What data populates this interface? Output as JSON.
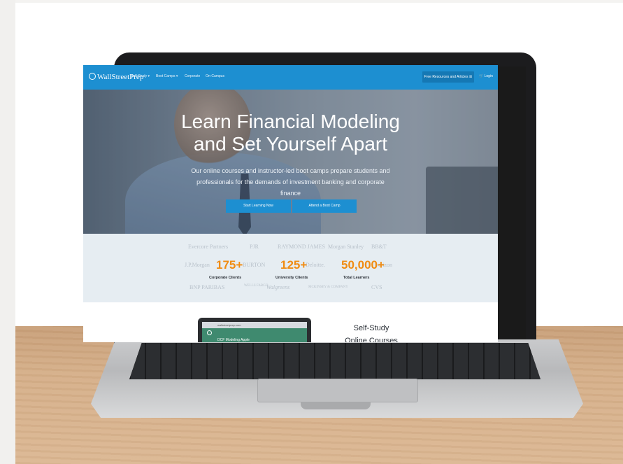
{
  "nav": {
    "logo": "WallStreetPrep",
    "items": [
      "Self-Study ▾",
      "Boot Camps ▾",
      "Corporate",
      "On-Campus"
    ],
    "resources": "Free Resources and Articles ☰",
    "cart_icon": "cart-icon",
    "login": "Login"
  },
  "hero": {
    "title_line1": "Learn Financial Modeling",
    "title_line2": "and Set Yourself Apart",
    "subtitle": "Our online courses and instructor-led boot camps prepare students and professionals for the demands of investment banking and corporate finance",
    "cta_primary": "Start Learning Now",
    "cta_secondary": "Attend a Boot Camp"
  },
  "logos": {
    "row1": [
      "Evercore Partners",
      "PJR",
      "RAYMOND JAMES",
      "Morgan Stanley",
      "BB&T"
    ],
    "row2_left": "J.P.Morgan",
    "row2_mid1": "BURTON",
    "row2_mid2": "Deloitte.",
    "row2_right": "verizon",
    "row3": [
      "BNP PARIBAS",
      "WELLS FARGO",
      "Walgreens",
      "MCKINSEY & COMPANY",
      "CVS"
    ]
  },
  "stats": [
    {
      "number": "175+",
      "label": "Corporate Clients"
    },
    {
      "number": "125+",
      "label": "University Clients"
    },
    {
      "number": "50,000+",
      "label": "Total Learners"
    }
  ],
  "lower": {
    "mini_course": "DCF Modeling Apple",
    "self_study_line1": "Self-Study",
    "self_study_line2": "Online Courses"
  },
  "colors": {
    "nav_blue": "#1d8fd1",
    "stat_orange": "#f08c13",
    "logo_band": "#e6edf2"
  }
}
